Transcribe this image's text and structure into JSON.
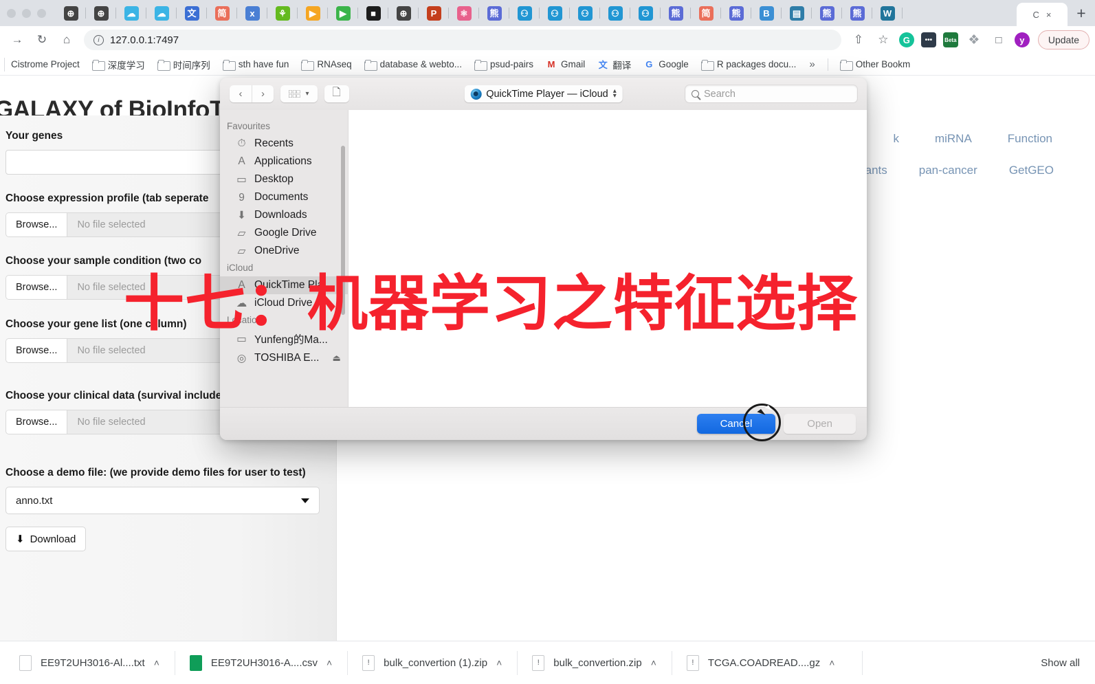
{
  "browser": {
    "tabs": [
      {
        "icon": "globe-icon",
        "color": "#444444",
        "glyph": "⊕"
      },
      {
        "icon": "globe-icon",
        "color": "#444444",
        "glyph": "⊕"
      },
      {
        "icon": "cloud-icon",
        "color": "#3bb4e5",
        "glyph": "☁"
      },
      {
        "icon": "cloud-icon",
        "color": "#3bb4e5",
        "glyph": "☁"
      },
      {
        "icon": "translate-icon",
        "color": "#3b6fd4",
        "glyph": "文"
      },
      {
        "icon": "jianshu-icon",
        "color": "#ea6f5a",
        "glyph": "简"
      },
      {
        "icon": "dx-icon",
        "color": "#4a7fd4",
        "glyph": "х"
      },
      {
        "icon": "biotree-icon",
        "color": "#64ba1f",
        "glyph": "⚘"
      },
      {
        "icon": "player-icon",
        "color": "#f5a623",
        "glyph": "▶"
      },
      {
        "icon": "player-icon",
        "color": "#3bb44a",
        "glyph": "▶"
      },
      {
        "icon": "video-icon",
        "color": "#1c1c1c",
        "glyph": "■"
      },
      {
        "icon": "globe-icon",
        "color": "#444444",
        "glyph": "⊕"
      },
      {
        "icon": "powerpoint-icon",
        "color": "#c43e1c",
        "glyph": "P"
      },
      {
        "icon": "atom-icon",
        "color": "#e8618c",
        "glyph": "⚛"
      },
      {
        "icon": "baidu-icon",
        "color": "#5b6bd6",
        "glyph": "熊"
      },
      {
        "icon": "robot-icon",
        "color": "#2196d3",
        "glyph": "⚇"
      },
      {
        "icon": "robot-icon",
        "color": "#2196d3",
        "glyph": "⚇"
      },
      {
        "icon": "robot-icon",
        "color": "#2196d3",
        "glyph": "⚇"
      },
      {
        "icon": "robot-icon",
        "color": "#2196d3",
        "glyph": "⚇"
      },
      {
        "icon": "robot-icon",
        "color": "#2196d3",
        "glyph": "⚇"
      },
      {
        "icon": "baidu-icon",
        "color": "#5b6bd6",
        "glyph": "熊"
      },
      {
        "icon": "jianshu-icon",
        "color": "#ea6f5a",
        "glyph": "简"
      },
      {
        "icon": "baidu-icon",
        "color": "#5b6bd6",
        "glyph": "熊"
      },
      {
        "icon": "bilibili-icon",
        "color": "#3b8fd4",
        "glyph": "B"
      },
      {
        "icon": "news-icon",
        "color": "#2f7da8",
        "glyph": "▤"
      },
      {
        "icon": "baidu-icon",
        "color": "#5b6bd6",
        "glyph": "熊"
      },
      {
        "icon": "baidu-icon",
        "color": "#5b6bd6",
        "glyph": "熊"
      },
      {
        "icon": "wordpress-icon",
        "color": "#21759b",
        "glyph": "W"
      }
    ],
    "active_tab_label": "C",
    "active_tab_close": "×",
    "new_tab_label": "+",
    "toolbar": {
      "back": "←",
      "forward": "→",
      "reload": "↻",
      "home": "⌂",
      "url": "127.0.0.1:7497",
      "share": "⇧",
      "bookmark_star": "☆",
      "update_label": "Update"
    },
    "extensions": [
      {
        "name": "grammarly-icon",
        "glyph": "G",
        "color": "#15c39a"
      },
      {
        "name": "dots-extension-icon",
        "glyph": "•••",
        "color": "#2f3b49"
      },
      {
        "name": "beta-extension-icon",
        "glyph": "Beta",
        "color": "#1f7a3d"
      },
      {
        "name": "puzzle-icon",
        "glyph": "❖",
        "color": "#9aa0a6"
      },
      {
        "name": "sidepanel-icon",
        "glyph": "□",
        "color": "#5f6368"
      },
      {
        "name": "profile-avatar",
        "glyph": "y",
        "color": "#a020c0"
      }
    ],
    "bookmarks": [
      {
        "label": "Cistrome Project",
        "folder": false
      },
      {
        "label": "深度学习",
        "folder": true
      },
      {
        "label": "时间序列",
        "folder": true
      },
      {
        "label": "sth have fun",
        "folder": true
      },
      {
        "label": "RNAseq",
        "folder": true
      },
      {
        "label": "database & webto...",
        "folder": true
      },
      {
        "label": "psud-pairs",
        "folder": true
      },
      {
        "label": "Gmail",
        "folder": false,
        "icon": "gmail-icon"
      },
      {
        "label": "翻译",
        "folder": false,
        "icon": "translate-icon"
      },
      {
        "label": "Google",
        "folder": false,
        "icon": "google-icon"
      },
      {
        "label": "R packages docu...",
        "folder": true
      }
    ],
    "bookmarks_overflow": "»",
    "other_bookmarks": "Other Bookm"
  },
  "page": {
    "title": "GALAXY of BioInfoTo",
    "nav_row1": [
      "k",
      "miRNA",
      "Function"
    ],
    "nav_row2": [
      "riants",
      "pan-cancer",
      "GetGEO"
    ],
    "form": {
      "genes_label": "Your genes",
      "genes_value": "",
      "expression_label": "Choose expression profile (tab seperate",
      "sample_label": "Choose your sample condition (two co",
      "genelist_label": "Choose your gene list (one column)",
      "clinical_label": "Choose your clinical data (survival included)",
      "demo_label": "Choose a demo file: (we provide demo files for user to test)",
      "browse_label": "Browse...",
      "no_file_label": "No file selected",
      "demo_value": "anno.txt",
      "download_label": "Download",
      "download_icon": "download-icon"
    }
  },
  "annotation": {
    "text": "十七：机器学习之特征选择",
    "color": "#f5222d"
  },
  "dialog": {
    "back_icon": "chevron-left-icon",
    "forward_icon": "chevron-right-icon",
    "view_icon": "view-options-icon",
    "newfolder_icon": "new-folder-icon",
    "location_label": "QuickTime Player — iCloud",
    "location_icon": "quicktime-icon",
    "search_placeholder": "Search",
    "search_icon": "search-icon",
    "sidebar": [
      {
        "type": "header",
        "label": "Favourites"
      },
      {
        "type": "item",
        "label": "Recents",
        "icon": "recents-icon",
        "glyph": "⏱",
        "selected": false
      },
      {
        "type": "item",
        "label": "Applications",
        "icon": "applications-icon",
        "glyph": "A",
        "selected": false
      },
      {
        "type": "item",
        "label": "Desktop",
        "icon": "desktop-icon",
        "glyph": "▭",
        "selected": false
      },
      {
        "type": "item",
        "label": "Documents",
        "icon": "documents-icon",
        "glyph": "὜9",
        "selected": false
      },
      {
        "type": "item",
        "label": "Downloads",
        "icon": "downloads-icon",
        "glyph": "⬇",
        "selected": false
      },
      {
        "type": "item",
        "label": "Google Drive",
        "icon": "folder-icon",
        "glyph": "▱",
        "selected": false
      },
      {
        "type": "item",
        "label": "OneDrive",
        "icon": "folder-icon",
        "glyph": "▱",
        "selected": false
      },
      {
        "type": "header",
        "label": "iCloud"
      },
      {
        "type": "item",
        "label": "QuickTime Pla...",
        "icon": "applications-icon",
        "glyph": "A",
        "selected": true
      },
      {
        "type": "item",
        "label": "iCloud Drive",
        "icon": "icloud-icon",
        "glyph": "☁",
        "selected": false
      },
      {
        "type": "header",
        "label": "Locations"
      },
      {
        "type": "item",
        "label": "Yunfeng的Ma...",
        "icon": "laptop-icon",
        "glyph": "▭",
        "selected": false
      },
      {
        "type": "item",
        "label": "TOSHIBA E...",
        "icon": "disk-icon",
        "glyph": "◎",
        "selected": false,
        "eject": "⏏"
      }
    ],
    "cancel_label": "Cancel",
    "open_label": "Open"
  },
  "downloads": {
    "items": [
      {
        "name": "EE9T2UH3016-Al....txt",
        "kind": "txt",
        "chevron": "˄"
      },
      {
        "name": "EE9T2UH3016-A....csv",
        "kind": "csv",
        "chevron": "˄"
      },
      {
        "name": "bulk_convertion (1).zip",
        "kind": "zip",
        "chevron": "˄"
      },
      {
        "name": "bulk_convertion.zip",
        "kind": "zip",
        "chevron": "˄"
      },
      {
        "name": "TCGA.COADREAD....gz",
        "kind": "zip",
        "chevron": "˄"
      }
    ],
    "show_all": "Show all"
  }
}
